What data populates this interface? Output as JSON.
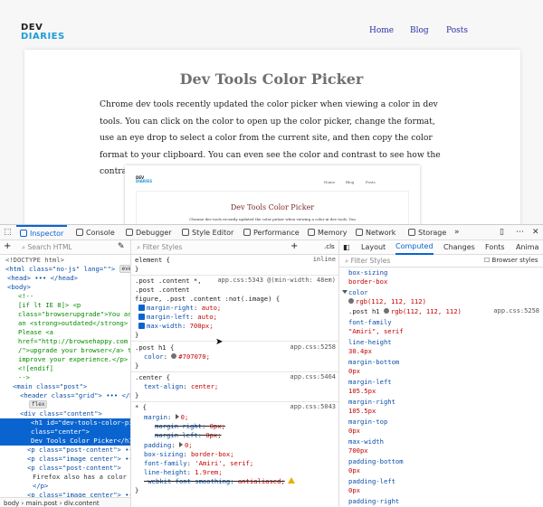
{
  "site": {
    "logo_line1": "DEV",
    "logo_line2": "DIARIES",
    "nav": [
      "Home",
      "Blog",
      "Posts"
    ],
    "title": "Dev Tools Color Picker",
    "body": "Chrome dev tools recently updated the color picker when viewing a color in dev tools. You can click on the color to open up the color picker, change the format, use an eye drop to select a color from the current site, and then copy the color format to your clipboard. You can even see the color and contrast to see how the contrast ratio affects accessibility.",
    "embedded": {
      "logo_line1": "DEV",
      "logo_line2": "DIARIES",
      "nav": [
        "Home",
        "Blog",
        "Posts"
      ],
      "title": "Dev Tools Color Picker",
      "body": "Chrome dev tools recently updated the color picker when viewing a color in dev tools. You"
    }
  },
  "devtools": {
    "tabs": [
      "Inspector",
      "Console",
      "Debugger",
      "Style Editor",
      "Performance",
      "Memory",
      "Network",
      "Storage"
    ],
    "more": "»",
    "markup": {
      "search_placeholder": "Search HTML",
      "lines": [
        "<!DOCTYPE html>",
        "<html class=\"no-js\" lang=\"\">",
        "<head> ••• </head>",
        "<body>",
        "<!--",
        "[if lt IE 8]> <p",
        "class=\"browserupgrade\">You are using",
        "an <strong>outdated</strong> browser.",
        "Please <a",
        "href=\"http://browsehappy.com",
        "/\">upgrade your browser</a> to",
        "improve your experience.</p>",
        "<![endif]",
        "-->",
        "<main class=\"post\">",
        "<header class=\"grid\"> ••• </header>",
        "flex",
        "<div class=\"content\">",
        "<h1 id=\"dev-tools-color-picker\"",
        "class=\"center\">",
        "Dev Tools Color Picker</h1>",
        "<p class=\"post-content\"> ••• </p>",
        "<p class=\"image center\"> ••• </p>",
        "<p class=\"post-content\">",
        "Firefox also has a color picker",
        "</p>",
        "<p class=\"image center\"> ••• </p>"
      ],
      "breadcrumbs": [
        "body",
        "main.post",
        "div.content"
      ],
      "html_badge": "event"
    },
    "rules": {
      "filter_placeholder": "Filter Styles",
      "cls": ".cls",
      "element": "element",
      "inline": "inline",
      "r1_selectors": [
        ".post .content *,",
        ".post .content",
        "figure, .post .content :not(.image)"
      ],
      "r1_source": "app.css:5343 @(min-width: 48em)",
      "r1_props": [
        [
          "margin-right",
          "auto;"
        ],
        [
          "margin-left",
          "auto;"
        ],
        [
          "max-width",
          "700px;"
        ]
      ],
      "r2_selector": ".post h1",
      "r2_source": "app.css:5258",
      "r2_prop": [
        "color",
        "#707070;"
      ],
      "r3_selector": ".center",
      "r3_source": "app.css:5464",
      "r3_prop": [
        "text-align",
        "center;"
      ],
      "r4_selector": "*",
      "r4_source": "app.css:5043",
      "r4_props": [
        [
          "margin",
          "0;"
        ],
        [
          "margin-right",
          "0px;"
        ],
        [
          "margin-left",
          "0px;"
        ],
        [
          "padding",
          "0;"
        ],
        [
          "box-sizing",
          "border-box;"
        ],
        [
          "font-family",
          "'Amiri', serif;"
        ],
        [
          "line-height",
          "1.9rem;"
        ],
        [
          "-webkit-font-smoothing",
          "antialiased;"
        ]
      ]
    },
    "computed": {
      "tabs": [
        "Layout",
        "Computed",
        "Changes",
        "Fonts",
        "Anima"
      ],
      "filter_placeholder": "Filter Styles",
      "browser_styles": "Browser styles",
      "props": [
        [
          "box-sizing",
          "border-box"
        ],
        [
          "color",
          "rgb(112, 112, 112)"
        ],
        [
          "font-family",
          "\"Amiri\", serif"
        ],
        [
          "line-height",
          "30.4px"
        ],
        [
          "margin-bottom",
          "0px"
        ],
        [
          "margin-left",
          "105.5px"
        ],
        [
          "margin-right",
          "105.5px"
        ],
        [
          "margin-top",
          "0px"
        ],
        [
          "max-width",
          "700px"
        ],
        [
          "padding-bottom",
          "0px"
        ],
        [
          "padding-left",
          "0px"
        ],
        [
          "padding-right",
          ""
        ]
      ],
      "color_detail_selector": ".post h1",
      "color_detail_value": "rgb(112, 112, 112)",
      "color_detail_source": "app.css:5258"
    }
  }
}
